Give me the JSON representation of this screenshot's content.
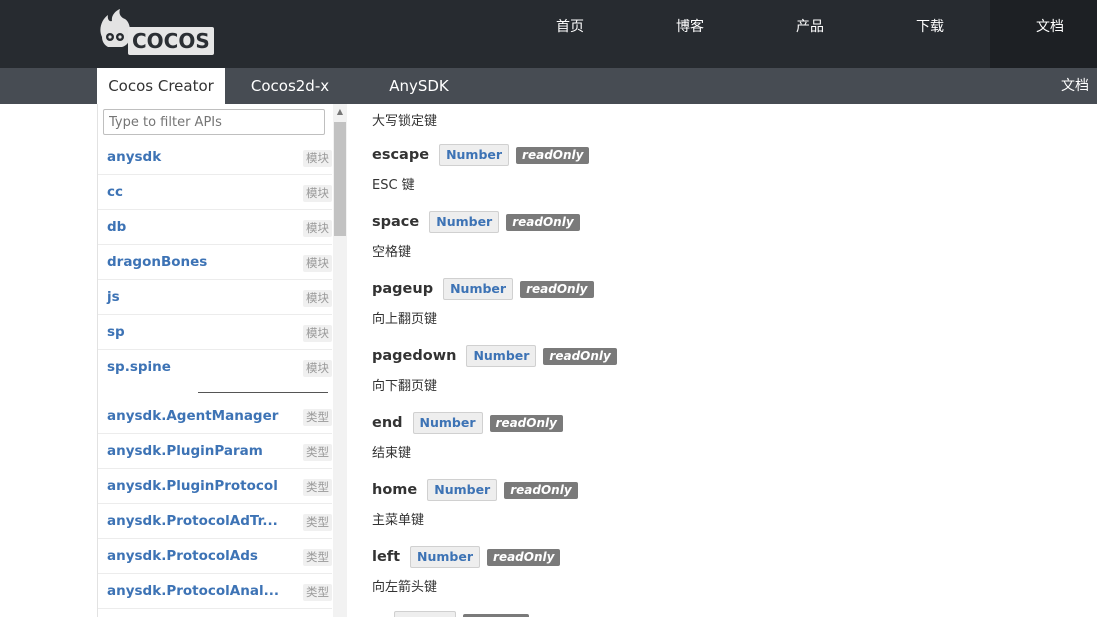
{
  "header": {
    "logo_text": "COCOS",
    "nav": [
      "首页",
      "博客",
      "产品",
      "下载",
      "文档"
    ],
    "active_nav": 4
  },
  "subnav": {
    "tabs": [
      "Cocos Creator",
      "Cocos2d-x",
      "AnySDK"
    ],
    "active_tab": 0,
    "right_label": "文档"
  },
  "sidebar": {
    "filter_placeholder": "Type to filter APIs",
    "modules": [
      {
        "name": "anysdk",
        "badge": "模块"
      },
      {
        "name": "cc",
        "badge": "模块"
      },
      {
        "name": "db",
        "badge": "模块"
      },
      {
        "name": "dragonBones",
        "badge": "模块"
      },
      {
        "name": "js",
        "badge": "模块"
      },
      {
        "name": "sp",
        "badge": "模块"
      },
      {
        "name": "sp.spine",
        "badge": "模块"
      }
    ],
    "classes": [
      {
        "name": "anysdk.AgentManager",
        "badge": "类型"
      },
      {
        "name": "anysdk.PluginParam",
        "badge": "类型"
      },
      {
        "name": "anysdk.PluginProtocol",
        "badge": "类型"
      },
      {
        "name": "anysdk.ProtocolAdTr...",
        "badge": "类型"
      },
      {
        "name": "anysdk.ProtocolAds",
        "badge": "类型"
      },
      {
        "name": "anysdk.ProtocolAnal...",
        "badge": "类型"
      }
    ]
  },
  "content": {
    "top_desc": "大写锁定键",
    "properties": [
      {
        "name": "escape",
        "type": "Number",
        "flag": "readOnly",
        "desc": "ESC 键"
      },
      {
        "name": "space",
        "type": "Number",
        "flag": "readOnly",
        "desc": "空格键"
      },
      {
        "name": "pageup",
        "type": "Number",
        "flag": "readOnly",
        "desc": "向上翻页键"
      },
      {
        "name": "pagedown",
        "type": "Number",
        "flag": "readOnly",
        "desc": "向下翻页键"
      },
      {
        "name": "end",
        "type": "Number",
        "flag": "readOnly",
        "desc": "结束键"
      },
      {
        "name": "home",
        "type": "Number",
        "flag": "readOnly",
        "desc": "主菜单键"
      },
      {
        "name": "left",
        "type": "Number",
        "flag": "readOnly",
        "desc": "向左箭头键"
      }
    ]
  }
}
